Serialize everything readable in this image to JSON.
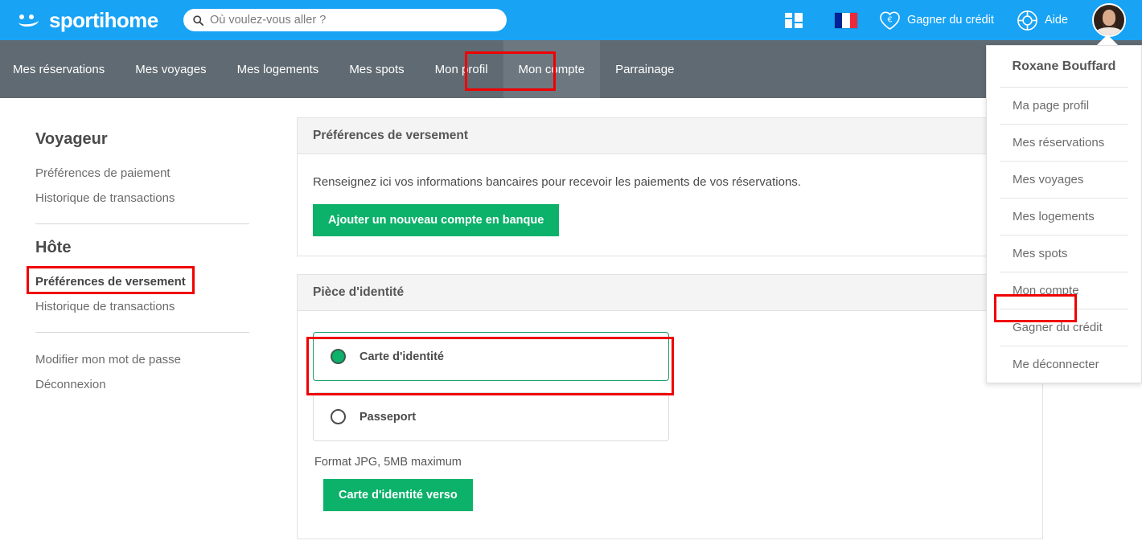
{
  "brand": {
    "name": "sportihome",
    "logo_icon": "smiley-face-icon"
  },
  "search": {
    "placeholder": "Où voulez-vous aller ?",
    "value": "",
    "icon": "search-icon"
  },
  "topbar": {
    "grid_icon": "grid-dashboard-icon",
    "flag_icon": "french-flag-icon",
    "credit": {
      "label": "Gagner du crédit",
      "icon": "heart-euro-icon"
    },
    "help": {
      "label": "Aide",
      "icon": "lifebuoy-icon"
    },
    "avatar": "user-avatar"
  },
  "nav": {
    "items": [
      {
        "label": "Mes réservations",
        "active": false
      },
      {
        "label": "Mes voyages",
        "active": false
      },
      {
        "label": "Mes logements",
        "active": false
      },
      {
        "label": "Mes spots",
        "active": false
      },
      {
        "label": "Mon profil",
        "active": false
      },
      {
        "label": "Mon compte",
        "active": true
      },
      {
        "label": "Parrainage",
        "active": false
      }
    ]
  },
  "sidebar": {
    "traveller_heading": "Voyageur",
    "traveller_items": [
      {
        "label": "Préférences de paiement"
      },
      {
        "label": "Historique de transactions"
      }
    ],
    "host_heading": "Hôte",
    "host_items": [
      {
        "label": "Préférences de versement",
        "active": true
      },
      {
        "label": "Historique de transactions",
        "active": false
      }
    ],
    "account_items": [
      {
        "label": "Modifier mon mot de passe"
      },
      {
        "label": "Déconnexion"
      }
    ]
  },
  "payout_panel": {
    "title": "Préférences de versement",
    "description": "Renseignez ici vos informations bancaires pour recevoir les paiements de vos réservations.",
    "add_bank_button": "Ajouter un nouveau compte en banque"
  },
  "identity_panel": {
    "title": "Pièce d'identité",
    "options": [
      {
        "label": "Carte d'identité",
        "selected": true
      },
      {
        "label": "Passeport",
        "selected": false
      }
    ],
    "format_note": "Format JPG, 5MB maximum",
    "upload_button": "Carte d'identité verso"
  },
  "user_menu": {
    "user_name": "Roxane Bouffard",
    "items": [
      {
        "label": "Ma page profil",
        "highlighted": false
      },
      {
        "label": "Mes réservations",
        "highlighted": false
      },
      {
        "label": "Mes voyages",
        "highlighted": false
      },
      {
        "label": "Mes logements",
        "highlighted": false
      },
      {
        "label": "Mes spots",
        "highlighted": false
      },
      {
        "label": "Mon compte",
        "highlighted": true
      },
      {
        "label": "Gagner du crédit",
        "highlighted": false
      },
      {
        "label": "Me déconnecter",
        "highlighted": false
      }
    ]
  },
  "colors": {
    "brand_blue": "#18a3f5",
    "nav_gray": "#5f6a72",
    "accent_green": "#0cb16a",
    "highlight_red": "#f00000"
  }
}
